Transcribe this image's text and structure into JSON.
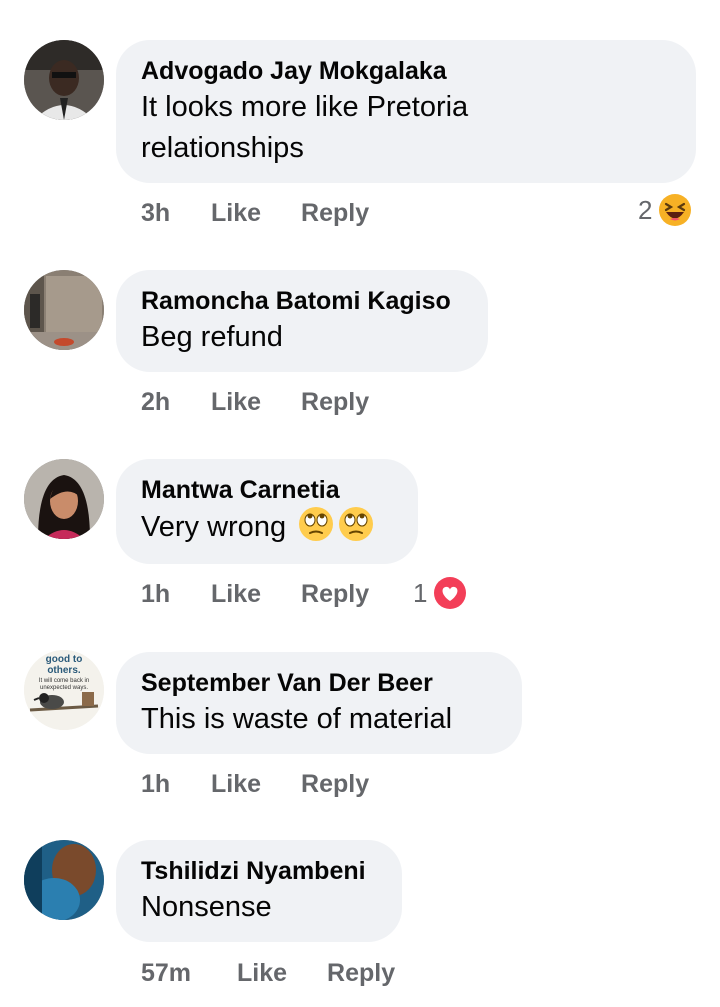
{
  "comments": [
    {
      "name": "Advogado Jay Mokgalaka",
      "text_line1": "It looks more like Pretoria",
      "text_line2": "relationships",
      "time": "3h",
      "like": "Like",
      "reply": "Reply",
      "reaction_count": "2",
      "reaction_icon": "laughing-face-icon"
    },
    {
      "name": "Ramoncha Batomi Kagiso",
      "text": "Beg refund",
      "time": "2h",
      "like": "Like",
      "reply": "Reply"
    },
    {
      "name": "Mantwa Carnetia",
      "text": "Very wrong",
      "text_emojis": [
        "eye-roll-emoji",
        "eye-roll-emoji"
      ],
      "time": "1h",
      "like": "Like",
      "reply": "Reply",
      "reaction_count": "1",
      "reaction_icon": "love-heart-icon"
    },
    {
      "name": "September Van Der Beer",
      "text": "This is waste of material",
      "time": "1h",
      "like": "Like",
      "reply": "Reply",
      "avatar_text_line1": "good to",
      "avatar_text_line2": "others.",
      "avatar_text_line3": "It will come back in",
      "avatar_text_line4": "unexpected ways."
    },
    {
      "name": "Tshilidzi Nyambeni",
      "text": "Nonsense",
      "time": "57m",
      "like": "Like",
      "reply": "Reply"
    }
  ],
  "colors": {
    "bubble_bg": "#f0f2f5",
    "meta_text": "#65676b",
    "name_text": "#050505",
    "love_red": "#f33e58",
    "haha_yellow": "#f7b125"
  }
}
